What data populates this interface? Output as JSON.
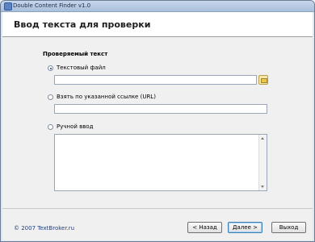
{
  "window": {
    "title": "Double Content Finder v1.0"
  },
  "header": {
    "title": "Ввод текста для проверки"
  },
  "form": {
    "section_title": "Проверяемый текст",
    "options": [
      {
        "label": "Текстовый файл",
        "selected": true
      },
      {
        "label": "Взять по указанной ссылке (URL)",
        "selected": false
      },
      {
        "label": "Ручной ввод",
        "selected": false
      }
    ],
    "file_path": "",
    "url": "",
    "manual_text": ""
  },
  "footer": {
    "copyright": "© 2007 TextBroker.ru",
    "back_label": "< Назад",
    "next_label": "Далее >",
    "exit_label": "Выход"
  }
}
